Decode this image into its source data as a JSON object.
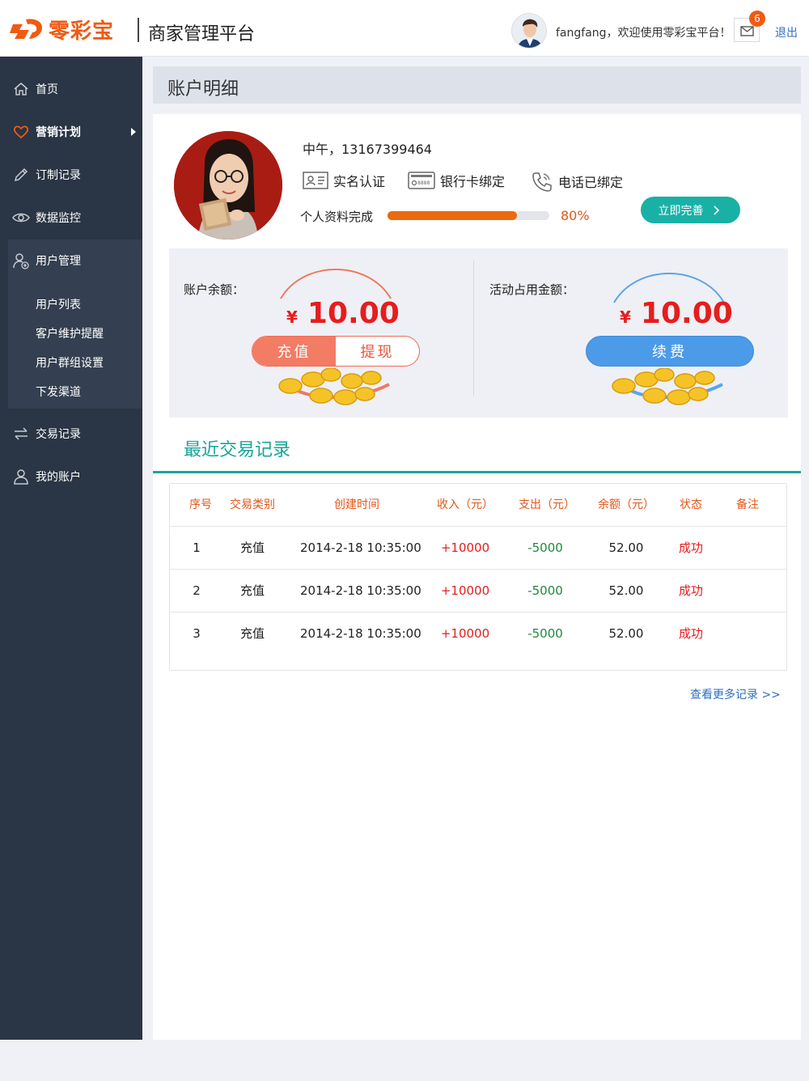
{
  "brand": {
    "name": "零彩宝",
    "platform": "商家管理平台",
    "accent": "#f05a12"
  },
  "header": {
    "username": "fangfang",
    "welcome": "fangfang，欢迎使用零彩宝平台！",
    "mail_count": "6",
    "logout_label": "退出"
  },
  "sidebar": {
    "items": [
      {
        "label": "首页",
        "icon": "home-icon"
      },
      {
        "label": "营销计划",
        "icon": "heart-icon"
      },
      {
        "label": "订制记录",
        "icon": "pencil-icon"
      },
      {
        "label": "数据监控",
        "icon": "eye-icon"
      },
      {
        "label": "用户管理",
        "icon": "user-add-icon"
      },
      {
        "label": "交易记录",
        "icon": "exchange-icon"
      },
      {
        "label": "我的账户",
        "icon": "user-icon"
      }
    ],
    "sub_items": [
      "用户列表",
      "客户维护提醒",
      "用户群组设置",
      "下发渠道"
    ]
  },
  "page": {
    "title": "账户明细"
  },
  "profile": {
    "greeting": "中午，13167399464",
    "verifications": [
      {
        "label": "实名认证",
        "icon": "id-card-icon"
      },
      {
        "label": "银行卡绑定",
        "icon": "bank-card-icon"
      },
      {
        "label": "电话已绑定",
        "icon": "phone-icon"
      }
    ],
    "progress_label": "个人资料完成",
    "progress_value": 80,
    "progress_text": "80%",
    "complete_button": "立即完善"
  },
  "balance": {
    "account_label": "账户余额：",
    "currency": "¥",
    "account_amount": "10.00",
    "recharge_label": "充值",
    "withdraw_label": "提现",
    "activity_label": "活动占用金额：",
    "activity_amount": "10.00",
    "renew_label": "续费"
  },
  "transactions": {
    "title": "最近交易记录",
    "columns": [
      "序号",
      "交易类别",
      "创建时间",
      "收入（元）",
      "支出（元）",
      "余额（元）",
      "状态",
      "备注"
    ],
    "rows": [
      [
        "1",
        "充值",
        "2014-2-18 10:35:00",
        "+10000",
        "-5000",
        "52.00",
        "成功",
        ""
      ],
      [
        "2",
        "充值",
        "2014-2-18 10:35:00",
        "+10000",
        "-5000",
        "52.00",
        "成功",
        ""
      ],
      [
        "3",
        "充值",
        "2014-2-18 10:35:00",
        "+10000",
        "-5000",
        "52.00",
        "成功",
        ""
      ]
    ],
    "more_label": "查看更多记录 >>"
  }
}
